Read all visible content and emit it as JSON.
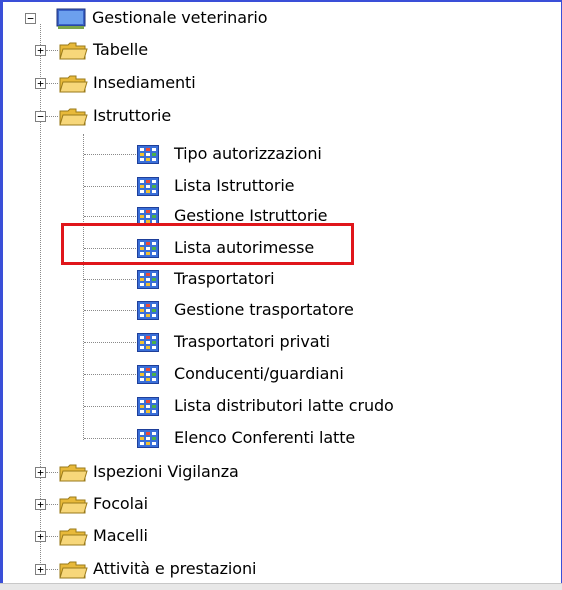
{
  "tree": {
    "root": {
      "label": "Gestionale veterinario",
      "icon": "computer-icon",
      "expanded": true
    },
    "folders": [
      {
        "label": "Tabelle",
        "expanded": false
      },
      {
        "label": "Insediamenti",
        "expanded": false
      },
      {
        "label": "Istruttorie",
        "expanded": true
      },
      {
        "label": "Ispezioni Vigilanza",
        "expanded": false
      },
      {
        "label": "Focolai",
        "expanded": false
      },
      {
        "label": "Macelli",
        "expanded": false
      },
      {
        "label": "Attività e prestazioni",
        "expanded": false
      }
    ],
    "istruttorie_items": [
      {
        "label": "Tipo autorizzazioni"
      },
      {
        "label": "Lista Istruttorie"
      },
      {
        "label": "Gestione Istruttorie"
      },
      {
        "label": "Lista autorimesse",
        "highlighted": true
      },
      {
        "label": "Trasportatori"
      },
      {
        "label": "Gestione trasportatore"
      },
      {
        "label": "Trasportatori privati"
      },
      {
        "label": "Conducenti/guardiani"
      },
      {
        "label": "Lista distributori latte crudo"
      },
      {
        "label": "Elenco Conferenti latte"
      }
    ],
    "expander_symbols": {
      "collapsed": "+",
      "expanded": "−"
    }
  },
  "colors": {
    "highlight": "#e0161b",
    "frame": "#3a4fd8",
    "folder": "#f2c94c",
    "grid_icon": "#3a6fd8"
  }
}
